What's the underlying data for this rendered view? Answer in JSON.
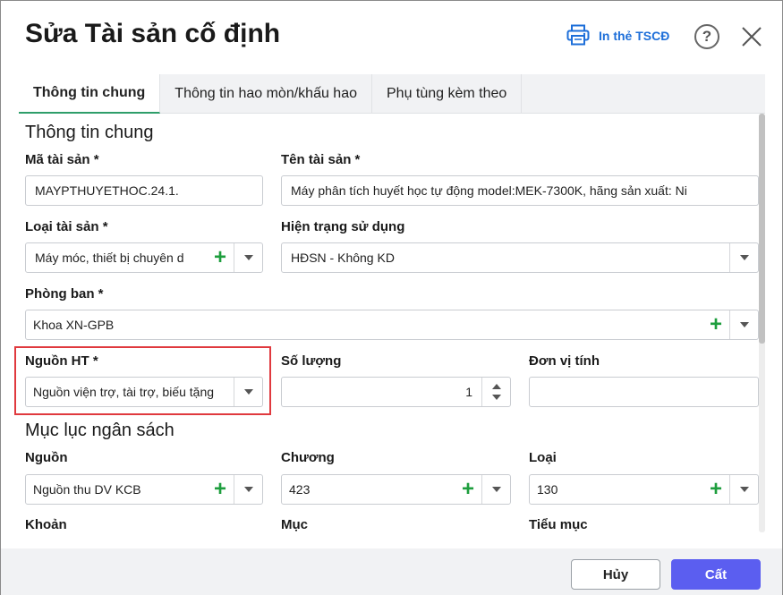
{
  "dialog": {
    "title": "Sửa Tài sản cố định",
    "print_label": "In thẻ TSCĐ",
    "help_label": "?"
  },
  "tabs": [
    {
      "label": "Thông tin chung",
      "active": true
    },
    {
      "label": "Thông tin hao mòn/khấu hao",
      "active": false
    },
    {
      "label": "Phụ tùng kèm theo",
      "active": false
    }
  ],
  "general": {
    "section_title": "Thông tin chung",
    "asset_code_label": "Mã tài sản *",
    "asset_code_value": "MAYPTHUYETHOC.24.1.",
    "asset_name_label": "Tên tài sản *",
    "asset_name_value": "Máy phân tích huyết học tự động model:MEK-7300K, hãng sản xuất: Ni",
    "asset_type_label": "Loại tài sản *",
    "asset_type_value": "Máy móc, thiết bị chuyên d",
    "usage_status_label": "Hiện trạng sử dụng",
    "usage_status_value": "HĐSN - Không KD",
    "department_label": "Phòng ban *",
    "department_value": "Khoa XN-GPB",
    "source_label": "Nguồn HT *",
    "source_value": "Nguồn viện trợ, tài trợ, biếu tặng",
    "quantity_label": "Số lượng",
    "quantity_value": "1",
    "unit_label": "Đơn vị tính",
    "unit_value": ""
  },
  "budget": {
    "section_title": "Mục lục ngân sách",
    "source_label": "Nguồn",
    "source_value": "Nguồn thu DV KCB",
    "chapter_label": "Chương",
    "chapter_value": "423",
    "type_label": "Loại",
    "type_value": "130",
    "item_label": "Khoản",
    "section_label": "Mục",
    "subsection_label": "Tiểu mục"
  },
  "footer": {
    "cancel_label": "Hủy",
    "save_label": "Cất"
  },
  "colors": {
    "accent": "#5b5ef0",
    "link": "#1e6fd9",
    "plus": "#1e9e3e",
    "highlight": "#e0393e",
    "tab_active_border": "#2e9e6a"
  }
}
